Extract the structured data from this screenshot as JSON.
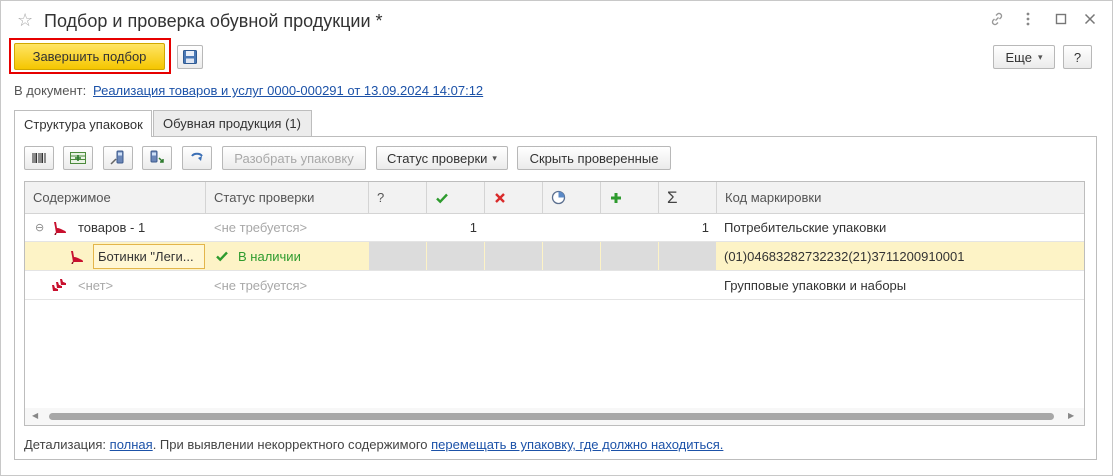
{
  "window": {
    "title": "Подбор и проверка обувной продукции *"
  },
  "toolbar": {
    "finish_label": "Завершить подбор",
    "more_label": "Еще",
    "help_label": "?"
  },
  "document": {
    "prefix": "В документ:",
    "link": "Реализация товаров и услуг 0000-000291 от 13.09.2024 14:07:12"
  },
  "tabs": [
    {
      "label": "Структура упаковок",
      "active": true
    },
    {
      "label": "Обувная продукция (1)",
      "active": false
    }
  ],
  "panel_toolbar": {
    "unpack_label": "Разобрать упаковку",
    "status_label": "Статус проверки",
    "hide_label": "Скрыть проверенные"
  },
  "columns": {
    "content": "Содержимое",
    "status": "Статус проверки",
    "unknown": "?",
    "code": "Код маркировки"
  },
  "rows": [
    {
      "content": "товаров - 1",
      "status": "<не требуется>",
      "ok": "1",
      "sum": "1",
      "code": "Потребительские упаковки"
    },
    {
      "content": "Ботинки \"Леги...",
      "status": "В наличии",
      "code": "(01)04683282732232(21)3711200910001"
    },
    {
      "content": "<нет>",
      "status": "<не требуется>",
      "code": "Групповые упаковки и наборы"
    }
  ],
  "footer": {
    "detail_prefix": "Детализация:",
    "detail_link": "полная",
    "middle_text": ". При выявлении некорректного содержимого",
    "move_link": "перемещать в упаковку, где должно находиться."
  },
  "colors": {
    "accent_yellow": "#f5c600",
    "highlight_red": "#e60000",
    "link": "#1c52a8",
    "selected_row": "#fdf3c6",
    "check_green": "#2e9b2e",
    "cross_red": "#d92b2b"
  }
}
